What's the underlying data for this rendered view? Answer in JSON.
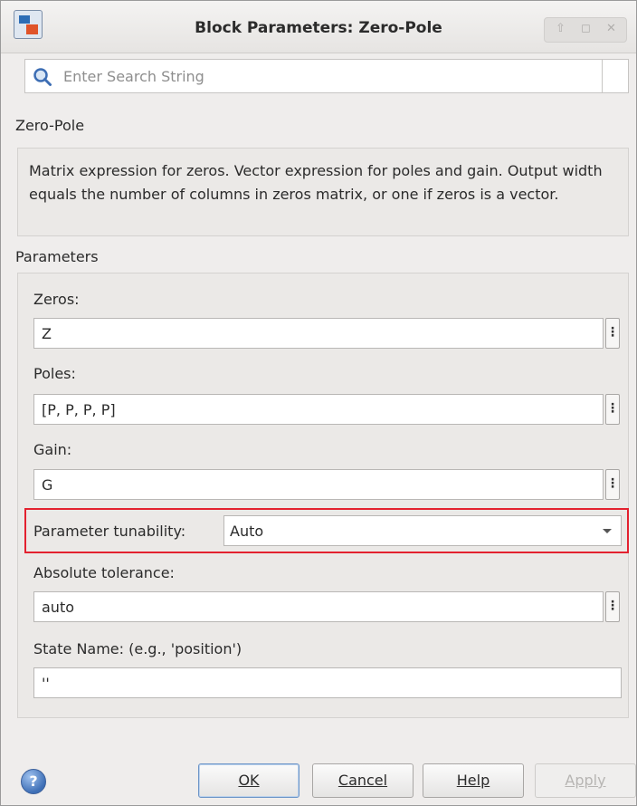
{
  "window": {
    "title": "Block Parameters: Zero-Pole"
  },
  "search": {
    "placeholder": "Enter Search String"
  },
  "block": {
    "name": "Zero-Pole",
    "description": "Matrix expression for zeros.  Vector expression for poles and gain. Output width equals the number of columns in zeros matrix, or one if zeros is a vector."
  },
  "parameters": {
    "section_label": "Parameters",
    "zeros": {
      "label": "Zeros:",
      "value": "Z"
    },
    "poles": {
      "label": "Poles:",
      "value": "[P, P, P, P]"
    },
    "gain": {
      "label": "Gain:",
      "value": "G"
    },
    "tunability": {
      "label": "Parameter tunability:",
      "value": "Auto"
    },
    "abs_tol": {
      "label": "Absolute tolerance:",
      "value": "auto"
    },
    "state_name": {
      "label": "State Name: (e.g., 'position')",
      "value": "''"
    }
  },
  "buttons": {
    "ok": "OK",
    "cancel": "Cancel",
    "help": "Help",
    "apply": "Apply"
  },
  "icons": {
    "app": "simulink-block-icon",
    "search": "search-icon",
    "help": "help-icon",
    "more": "vertical-ellipsis-icon",
    "dropdown": "chevron-down-icon"
  },
  "colors": {
    "highlight": "#e3212f"
  }
}
